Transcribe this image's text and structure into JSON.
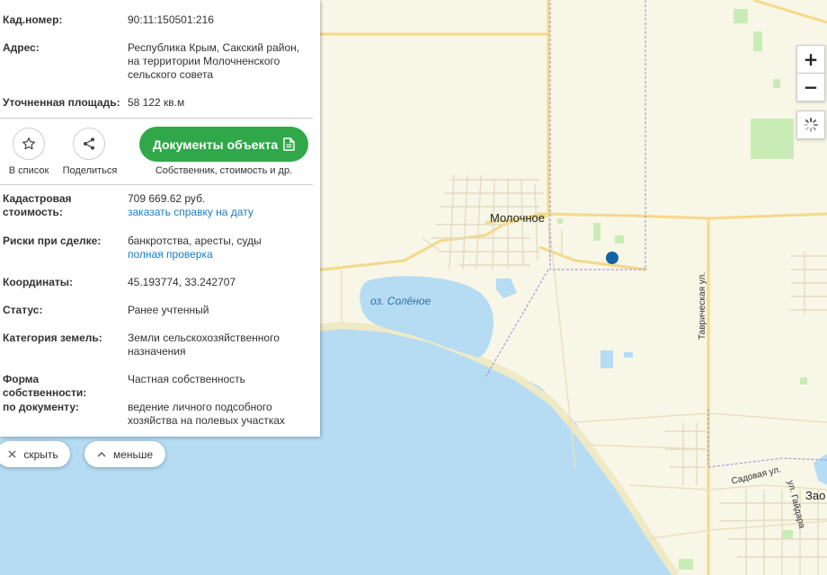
{
  "panel": {
    "rows_top": [
      {
        "key": "Кад.номер:",
        "value": "90:11:150501:216",
        "is_link": true
      },
      {
        "key": "Адрес:",
        "value": "Республика Крым, Сакский район, на территории Молочненского сельского совета"
      },
      {
        "key": "Уточненная площадь:",
        "value": "58 122 кв.м"
      }
    ],
    "actions": {
      "add_to_list": "В список",
      "share": "Поделиться",
      "documents_button": "Документы объекта",
      "documents_caption": "Собственник, стоимость и др."
    },
    "rows_bottom": [
      {
        "key": "Кадастровая стоимость:",
        "value": "709 669.62 руб.",
        "link": "заказать справку на дату"
      },
      {
        "key": "Риски при сделке:",
        "value": "банкротства, аресты, суды",
        "link": "полная проверка"
      },
      {
        "key": "Координаты:",
        "value": "45.193774, 33.242707"
      },
      {
        "key": "Статус:",
        "value": "Ранее учтенный"
      },
      {
        "key": "Категория земель:",
        "value": "Земли сельскохозяйственного назначения"
      },
      {
        "key": "Форма собственности:",
        "value": "Частная собственность"
      },
      {
        "key": "по документу:",
        "value": "ведение личного подсобного хозяйства на полевых участках"
      }
    ]
  },
  "bottom": {
    "hide_label": "скрыть",
    "less_label": "меньше"
  },
  "map": {
    "labels": {
      "village": "Молочное",
      "lake": "оз. Солёное",
      "street_tavricheskaya": "Таврическая ул.",
      "street_sadovaya": "Садовая ул.",
      "street_gaidara": "ул. Гайдара",
      "town_partial": "Зао"
    },
    "controls": {
      "zoom_in": "+",
      "zoom_out": "−"
    }
  },
  "colors": {
    "land": "#f8f6e6",
    "water": "#b5dcf3",
    "road": "#f3d98a",
    "green_area": "#c9ecb7",
    "marker": "#1463a8",
    "boundary": "#9a8bd4",
    "button_green": "#30a84a",
    "link": "#1a7cc2"
  },
  "icons": {
    "add_to_list": "star-icon",
    "share": "share-icon",
    "documents": "document-icon",
    "hide": "close-icon",
    "less": "chevron-up-icon",
    "layers": "loading-spinner-icon"
  }
}
